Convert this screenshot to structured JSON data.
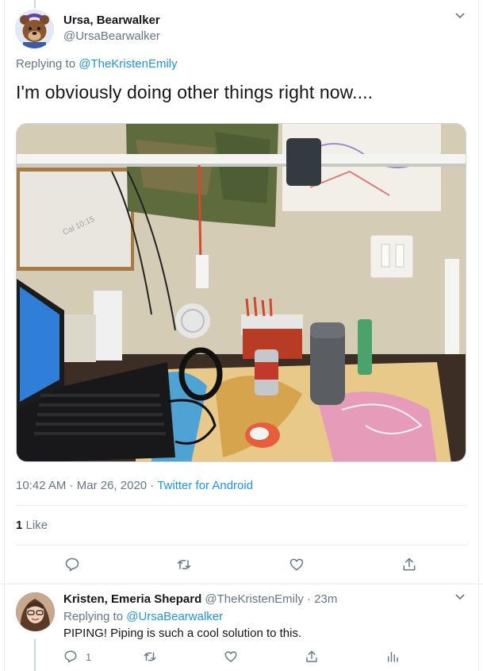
{
  "main_tweet": {
    "author_name": "Ursa, Bearwalker",
    "author_handle": "@UrsaBearwalker",
    "replying_prefix": "Replying to",
    "replying_to": "@TheKristenEmily",
    "text": "I'm obviously doing other things right now....",
    "time": "10:42 AM",
    "date": "Mar 26, 2020",
    "source": "Twitter for Android",
    "like_count": "1",
    "like_label": "Like",
    "photo_icon": "desk-photo"
  },
  "actions": {
    "reply_icon": "reply-icon",
    "retweet_icon": "retweet-icon",
    "like_icon": "heart-icon",
    "share_icon": "share-icon"
  },
  "reply_tweet": {
    "author_name": "Kristen, Emeria Shepard",
    "author_handle": "@TheKristenEmily",
    "time_ago": "23m",
    "replying_prefix": "Replying to",
    "replying_to": "@UrsaBearwalker",
    "text": "PIPING! Piping is such a cool solution to this.",
    "reply_count": "1",
    "analytics_icon": "analytics-icon"
  },
  "colors": {
    "link": "#1b95e0",
    "secondary_text": "#657786",
    "primary_text": "#14171a",
    "divider": "#e6ecf0"
  }
}
